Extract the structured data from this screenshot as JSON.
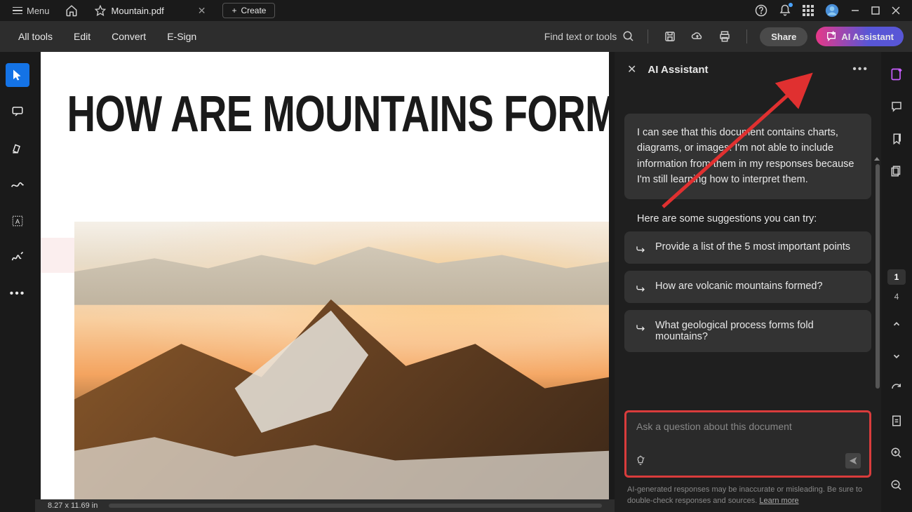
{
  "titlebar": {
    "menu_label": "Menu",
    "tab_name": "Mountain.pdf",
    "create_label": "Create"
  },
  "toolbar": {
    "items": [
      "All tools",
      "Edit",
      "Convert",
      "E-Sign"
    ],
    "find_label": "Find text or tools",
    "share_label": "Share",
    "ai_label": "AI Assistant"
  },
  "document": {
    "heading": "HOW ARE MOUNTAINS FORMED?",
    "page_size": "8.27 x 11.69 in"
  },
  "ai_panel": {
    "title": "AI Assistant",
    "intro_msg": "I can see that this document contains charts, diagrams, or images. I'm not able to include information from them in my responses because I'm still learning how to interpret them.",
    "suggest_header": "Here are some suggestions you can try:",
    "suggestions": [
      "Provide a list of the 5 most important points",
      "How are volcanic mountains formed?",
      "What geological process forms fold mountains?"
    ],
    "input_placeholder": "Ask a question about this document",
    "disclaimer": "AI-generated responses may be inaccurate or misleading. Be sure to double-check responses and sources. ",
    "learn_more": "Learn more"
  },
  "pagenav": {
    "current": "1",
    "total": "4"
  }
}
